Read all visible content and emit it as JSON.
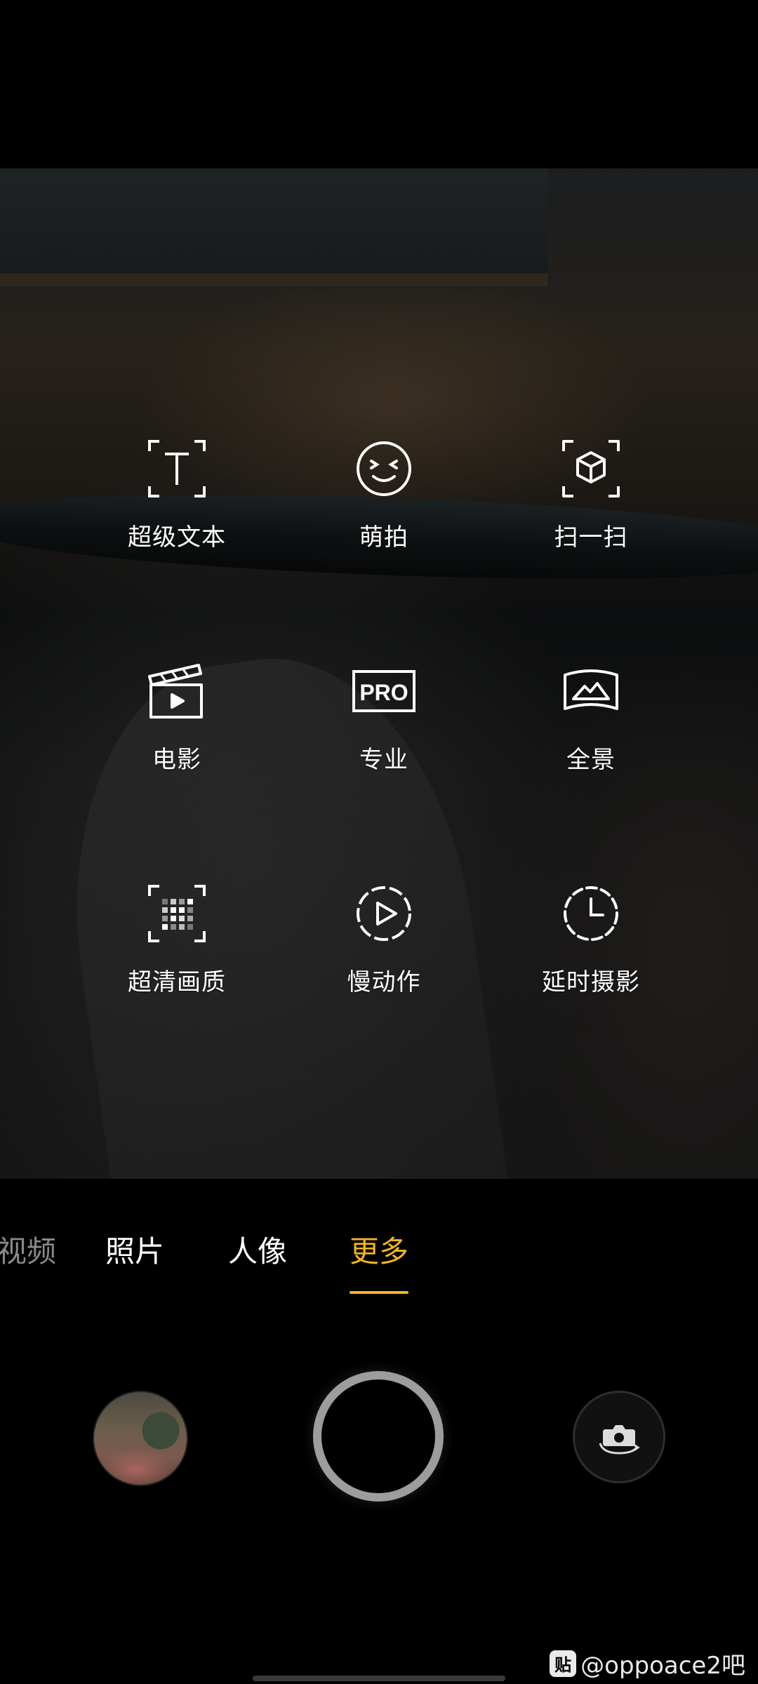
{
  "modes": [
    {
      "label": "超级文本",
      "icon": "super-text-icon"
    },
    {
      "label": "萌拍",
      "icon": "smiley-face-icon"
    },
    {
      "label": "扫一扫",
      "icon": "scan-cube-icon"
    },
    {
      "label": "电影",
      "icon": "clapperboard-icon"
    },
    {
      "label": "专业",
      "icon": "pro-badge-icon"
    },
    {
      "label": "全景",
      "icon": "panorama-mountain-icon"
    },
    {
      "label": "超清画质",
      "icon": "high-res-grid-icon"
    },
    {
      "label": "慢动作",
      "icon": "slow-motion-play-icon"
    },
    {
      "label": "延时摄影",
      "icon": "timelapse-clock-icon"
    }
  ],
  "mode_tabs": [
    {
      "label": "视频",
      "state": "dim"
    },
    {
      "label": "照片",
      "state": "normal"
    },
    {
      "label": "人像",
      "state": "normal"
    },
    {
      "label": "更多",
      "state": "active"
    }
  ],
  "pro_icon_text": "PRO",
  "watermark": {
    "badge": "贴",
    "text": "@oppoace2吧"
  },
  "colors": {
    "accent": "#f2b429",
    "text": "#ffffff",
    "dim_text": "#8a8a8a",
    "background": "#000000"
  }
}
